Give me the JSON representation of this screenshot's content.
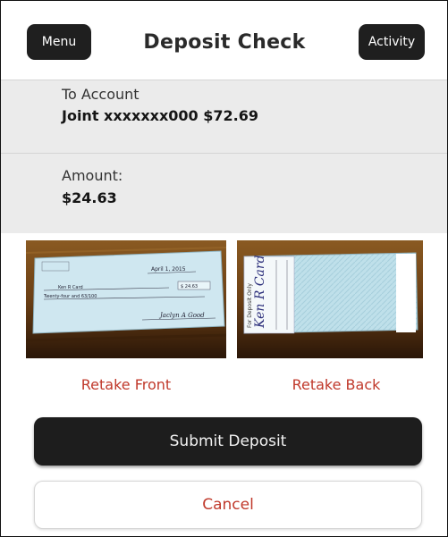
{
  "header": {
    "menu_label": "Menu",
    "title": "Deposit Check",
    "activity_label": "Activity"
  },
  "account": {
    "label": "To Account",
    "value": "Joint xxxxxxx000 $72.69"
  },
  "amount": {
    "label": "Amount:",
    "value": "$24.63"
  },
  "check_front": {
    "date": "April 1, 2015",
    "payee": "Ken R Card",
    "amount_box": "$ 24.63",
    "written_amount": "Twenty-four and 63/100",
    "signature": "Jaclyn A Good"
  },
  "check_back": {
    "endorsement": "Ken R Card",
    "note": "For Deposit Only"
  },
  "actions": {
    "retake_front": "Retake Front",
    "retake_back": "Retake Back",
    "submit": "Submit Deposit",
    "cancel": "Cancel"
  },
  "colors": {
    "accent_red": "#c0392b",
    "dark_button": "#1d1d1d",
    "info_background": "#ebebeb"
  }
}
